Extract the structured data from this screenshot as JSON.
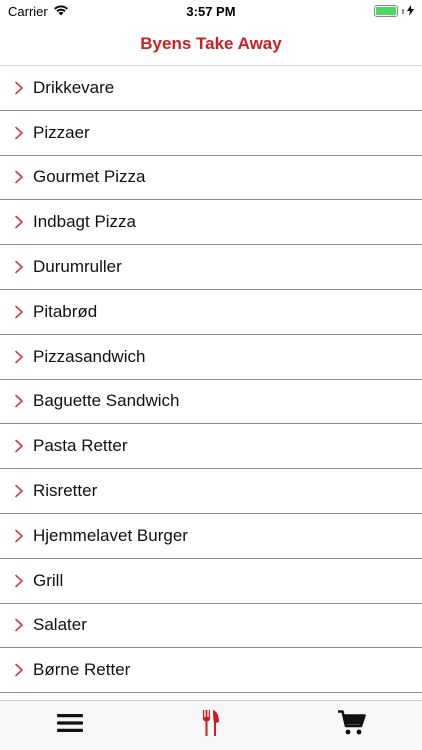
{
  "status_bar": {
    "carrier": "Carrier",
    "time": "3:57 PM",
    "battery_level": 1.0
  },
  "nav": {
    "title": "Byens Take Away"
  },
  "menu": {
    "items": [
      {
        "label": "Drikkevare"
      },
      {
        "label": "Pizzaer"
      },
      {
        "label": "Gourmet Pizza"
      },
      {
        "label": "Indbagt Pizza"
      },
      {
        "label": "Durumruller"
      },
      {
        "label": "Pitabrød"
      },
      {
        "label": "Pizzasandwich"
      },
      {
        "label": "Baguette Sandwich"
      },
      {
        "label": "Pasta Retter"
      },
      {
        "label": "Risretter"
      },
      {
        "label": "Hjemmelavet Burger"
      },
      {
        "label": "Grill"
      },
      {
        "label": "Salater"
      },
      {
        "label": "Børne Retter"
      }
    ]
  },
  "tab_bar": {
    "tabs": [
      {
        "icon": "hamburger-menu-icon",
        "active": false
      },
      {
        "icon": "fork-knife-icon",
        "active": true
      },
      {
        "icon": "shopping-cart-icon",
        "active": false
      }
    ]
  },
  "colors": {
    "accent": "#cc1f24",
    "chevron": "#cc3a3f",
    "battery": "#4cd964"
  }
}
